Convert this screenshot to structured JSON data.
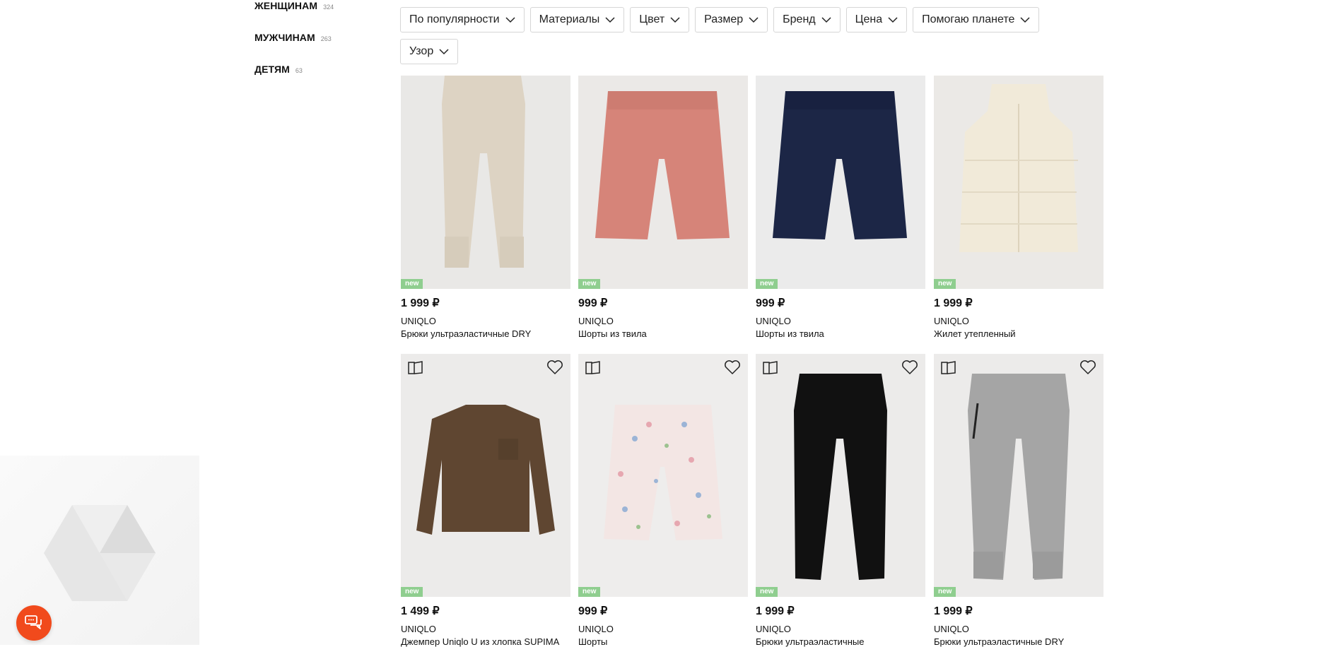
{
  "categories": [
    {
      "label": "ЖЕНЩИНАМ",
      "count": "324"
    },
    {
      "label": "МУЖЧИНАМ",
      "count": "263"
    },
    {
      "label": "ДЕТЯМ",
      "count": "63"
    }
  ],
  "filters": [
    "По популярности",
    "Материалы",
    "Цвет",
    "Размер",
    "Бренд",
    "Цена",
    "Помогаю планете",
    "Узор"
  ],
  "products": [
    {
      "price": "1 999 ₽",
      "brand": "UNIQLO",
      "name": "Брюки ультраэластичные DRY",
      "badge": "new"
    },
    {
      "price": "999 ₽",
      "brand": "UNIQLO",
      "name": "Шорты из твила",
      "badge": "new"
    },
    {
      "price": "999 ₽",
      "brand": "UNIQLO",
      "name": "Шорты из твила",
      "badge": "new"
    },
    {
      "price": "1 999 ₽",
      "brand": "UNIQLO",
      "name": "Жилет утепленный",
      "badge": "new"
    },
    {
      "price": "1 499 ₽",
      "brand": "UNIQLO",
      "name": "Джемпер Uniqlo U из хлопка SUPIMA",
      "badge": "new"
    },
    {
      "price": "999 ₽",
      "brand": "UNIQLO",
      "name": "Шорты",
      "badge": "new"
    },
    {
      "price": "1 999 ₽",
      "brand": "UNIQLO",
      "name": "Брюки ультраэластичные",
      "badge": "new"
    },
    {
      "price": "1 999 ₽",
      "brand": "UNIQLO",
      "name": "Брюки ультраэластичные DRY",
      "badge": "new"
    }
  ],
  "icons": {
    "filter_chevron": "chevron-down-icon",
    "compare": "compare-icon",
    "favorite": "heart-icon",
    "chat": "chat-icon",
    "placeholder": "cube-icon"
  },
  "colors": {
    "accent": "#f14a1c",
    "new_badge": "#8fce8f",
    "image_bg": "#ececec"
  }
}
